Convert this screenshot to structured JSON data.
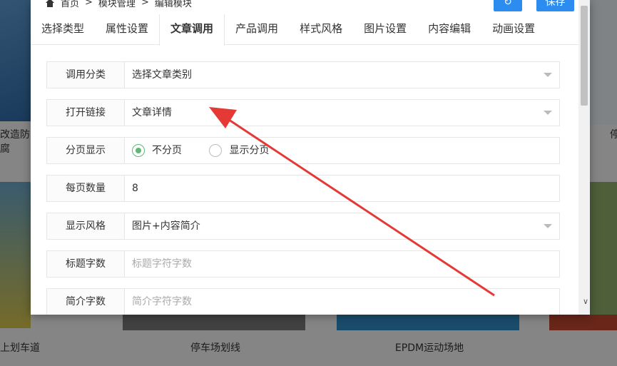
{
  "background": {
    "captions": [
      "改造防腐",
      "上划车道",
      "停车场划线",
      "EPDM运动场地",
      "停"
    ]
  },
  "breadcrumb": [
    "首页",
    ">",
    "模块管理",
    ">",
    "编辑模块"
  ],
  "toolbar": {
    "refresh_label": "↻",
    "save_label": "保存"
  },
  "tabs": [
    {
      "label": "选择类型"
    },
    {
      "label": "属性设置"
    },
    {
      "label": "文章调用",
      "active": true
    },
    {
      "label": "产品调用"
    },
    {
      "label": "样式风格"
    },
    {
      "label": "图片设置"
    },
    {
      "label": "内容编辑"
    },
    {
      "label": "动画设置"
    }
  ],
  "form": {
    "category": {
      "label": "调用分类",
      "value": "选择文章类别"
    },
    "open_link": {
      "label": "打开链接",
      "value": "文章详情"
    },
    "pagination": {
      "label": "分页显示",
      "options": [
        "不分页",
        "显示分页"
      ],
      "selected": "不分页"
    },
    "per_page": {
      "label": "每页数量",
      "value": "8"
    },
    "display_style": {
      "label": "显示风格",
      "value": "图片+内容简介"
    },
    "title_chars": {
      "label": "标题字数",
      "placeholder": "标题字符字数"
    },
    "intro_chars": {
      "label": "简介字数",
      "placeholder": "简介字符字数"
    }
  },
  "colors": {
    "primary": "#2d8cf0",
    "radio_checked": "#5fb878",
    "annotation_arrow": "#e53935"
  }
}
